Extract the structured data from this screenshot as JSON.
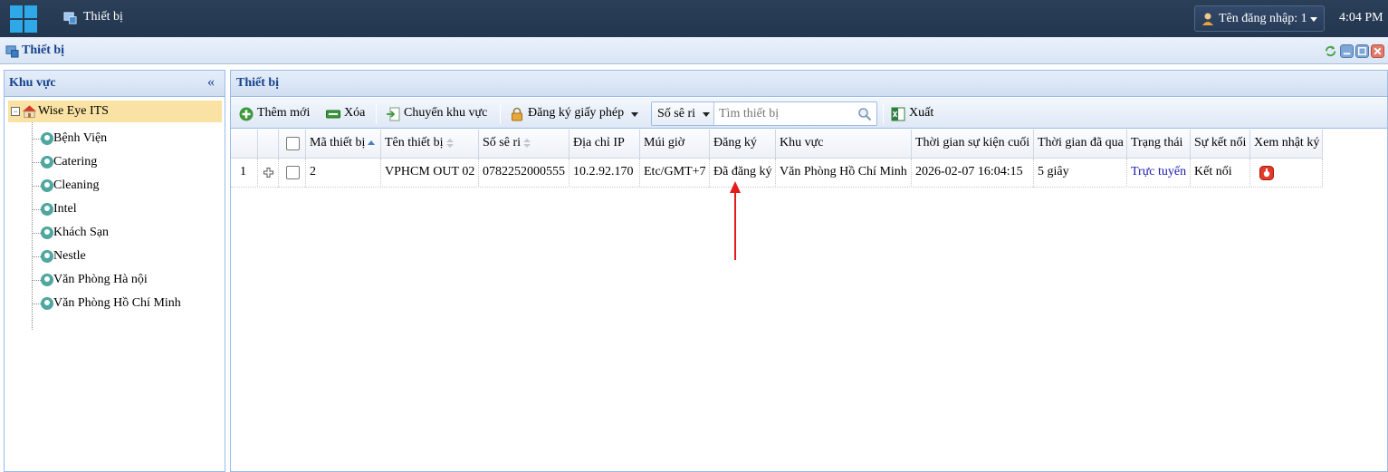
{
  "taskbar": {
    "app_title": "Thiết bị",
    "user_label": "Tên đăng nhập: 1",
    "clock": "4:04 PM"
  },
  "window": {
    "title": "Thiết bị"
  },
  "left_panel": {
    "title": "Khu vực",
    "collapse_glyph": "«",
    "root": "Wise Eye ITS",
    "items": [
      "Bệnh Viện",
      "Catering",
      "Cleaning",
      "Intel",
      "Khách Sạn",
      "Nestle",
      "Văn Phòng Hà nội",
      "Văn Phòng Hồ Chí Minh"
    ]
  },
  "right_panel": {
    "title": "Thiết bị",
    "toolbar": {
      "add": "Thêm mới",
      "delete": "Xóa",
      "move_area": "Chuyển khu vực",
      "license": "Đăng ký giấy phép",
      "search_field": "Số sê ri",
      "search_placeholder": "Tìm thiết bị",
      "export": "Xuất"
    },
    "columns": {
      "id": "Mã thiết bị",
      "name": "Tên thiết bị",
      "serial": "Số sê ri",
      "ip": "Địa chỉ IP",
      "timezone": "Múi giờ",
      "registration": "Đăng ký",
      "area": "Khu vực",
      "last_event": "Thời gian sự kiện cuối",
      "elapsed": "Thời gian đã qua",
      "status": "Trạng thái",
      "connection": "Sự kết nối",
      "log": "Xem nhật ký"
    },
    "rows": [
      {
        "index": "1",
        "id": "2",
        "name": "VPHCM OUT 02",
        "serial": "0782252000555",
        "ip": "10.2.92.170",
        "timezone": "Etc/GMT+7",
        "registration": "Đã đăng ký",
        "area": "Văn Phòng Hồ Chí Minh",
        "last_event": "2026-02-07 16:04:15",
        "elapsed": "5 giây",
        "status": "Trực tuyến",
        "connection": "Kết nối"
      }
    ]
  },
  "colors": {
    "taskbar": "#263a54",
    "header_text": "#15428b",
    "selected_tree": "#f9e2a3",
    "status_link": "#1a1ab0",
    "annotation_arrow": "#e31b1b"
  },
  "icons": [
    "windows-logo-icon",
    "device-icon",
    "user-icon",
    "refresh-icon",
    "minimize-icon",
    "restore-icon",
    "close-icon",
    "home-icon",
    "location-pin-icon",
    "add-icon",
    "delete-icon",
    "move-icon",
    "lock-icon",
    "search-icon",
    "export-icon",
    "expand-row-icon",
    "log-icon",
    "annotation-arrow-icon"
  ]
}
